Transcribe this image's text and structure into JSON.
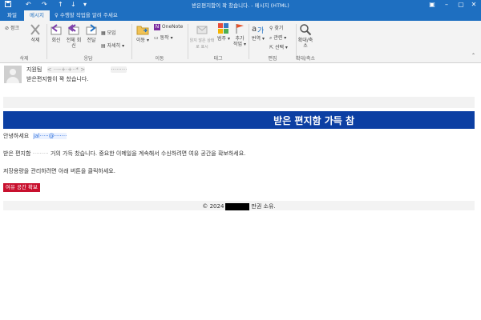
{
  "window": {
    "title": "받은편지함이 꽉 찼습니다. - 메시지 (HTML)",
    "qa_icons": [
      "save-icon",
      "undo-icon",
      "redo-icon",
      "up-arrow-icon",
      "down-arrow-icon",
      "more-icon"
    ]
  },
  "tabs": [
    {
      "label": "파일"
    },
    {
      "label": "메시지"
    }
  ],
  "tellme": "수행할 작업을 알려 주세요",
  "ribbon": {
    "groups": [
      {
        "label": "삭제"
      },
      {
        "label": "응답"
      },
      {
        "label": "이동"
      },
      {
        "label": "태그"
      },
      {
        "label": "편집"
      },
      {
        "label": "확대/축소"
      }
    ],
    "ignore": "정크",
    "delete": "삭제",
    "reply": "회신",
    "reply_all": "전체 회신",
    "forward": "전달",
    "meeting": "모임",
    "more": "자세히",
    "move": "이동",
    "onenote": "OneNote",
    "actions": "동작",
    "mark_unread": "읽지 않은 상태로 표시",
    "categorize": "범주",
    "follow_up": "추가 작업",
    "translate": "번역",
    "find": "찾기",
    "related": "관련",
    "select": "선택",
    "zoom": "확대/축소"
  },
  "message": {
    "sender_name": "지원팀",
    "sender_email": "< ··--+·+··* >",
    "to": "·········",
    "subject": "받은편지함이 꽉 찼습니다."
  },
  "body": {
    "banner": "받은 편지함 가득 참",
    "greeting": "안녕하세요",
    "greeting_email": "jal·····@·······",
    "line1_prefix": "받은 편지함",
    "line1_blur": "·········",
    "line1_suffix": "거의 가득 찼습니다. 중요한 이메일을 계속해서 수신하려면 여유 공간을 확보하세요.",
    "line2": "저장용량을 관리하려면 아래 버튼을 클릭하세요.",
    "cta": "여유 공간 확보",
    "footer_prefix": "© 2024",
    "footer_suffix": "판권 소유."
  },
  "colors": {
    "titlebar": "#1e6fc1",
    "banner": "#0c3fa3",
    "cta": "#c8102e"
  }
}
